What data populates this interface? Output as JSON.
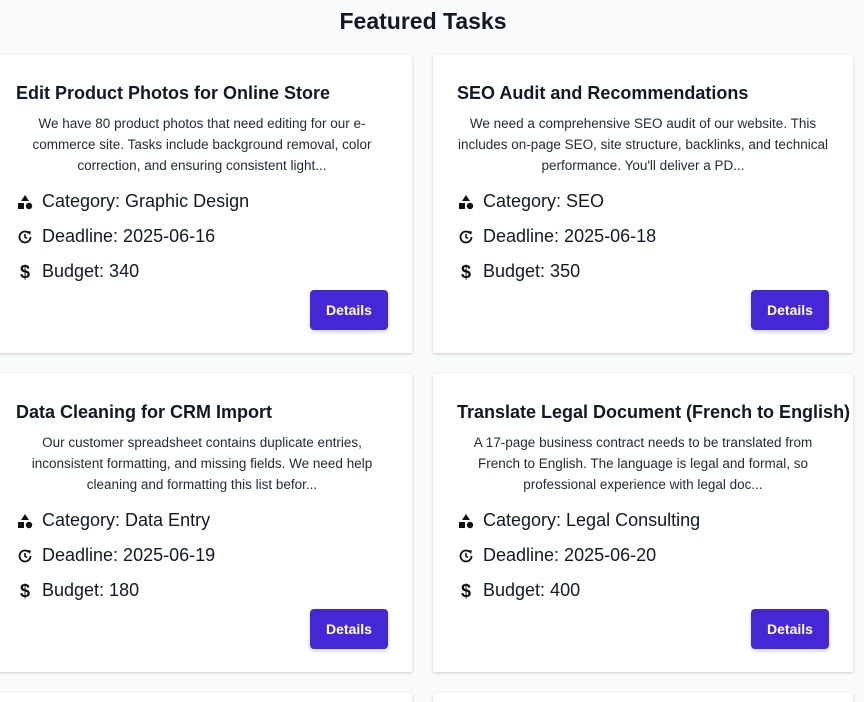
{
  "page_title": "Featured Tasks",
  "colors": {
    "accent": "#4527d6",
    "card_bg": "#ffffff",
    "page_bg": "#f9fafb"
  },
  "icons": {
    "category": "shapes-icon",
    "deadline": "clock-rotate-icon",
    "budget": "dollar-icon"
  },
  "tasks": [
    {
      "title": "Edit Product Photos for Online Store",
      "description": "We have 80 product photos that need editing for our e-commerce site. Tasks include background removal, color correction, and ensuring consistent light...",
      "category": "Category: Graphic Design",
      "deadline": "Deadline: 2025-06-16",
      "budget": "Budget: 340",
      "button_label": "Details"
    },
    {
      "title": "SEO Audit and Recommendations",
      "description": "We need a comprehensive SEO audit of our website. This includes on-page SEO, site structure, backlinks, and technical performance. You'll deliver a PD...",
      "category": "Category: SEO",
      "deadline": "Deadline: 2025-06-18",
      "budget": "Budget: 350",
      "button_label": "Details"
    },
    {
      "title": "Data Cleaning for CRM Import",
      "description": "Our customer spreadsheet contains duplicate entries, inconsistent formatting, and missing fields. We need help cleaning and formatting this list befor...",
      "category": "Category: Data Entry",
      "deadline": "Deadline: 2025-06-19",
      "budget": "Budget: 180",
      "button_label": "Details"
    },
    {
      "title": "Translate Legal Document (French to English)",
      "description": "A 17-page business contract needs to be translated from French to English. The language is legal and formal, so professional experience with legal doc...",
      "category": "Category: Legal Consulting",
      "deadline": "Deadline: 2025-06-20",
      "budget": "Budget: 400",
      "button_label": "Details"
    }
  ]
}
